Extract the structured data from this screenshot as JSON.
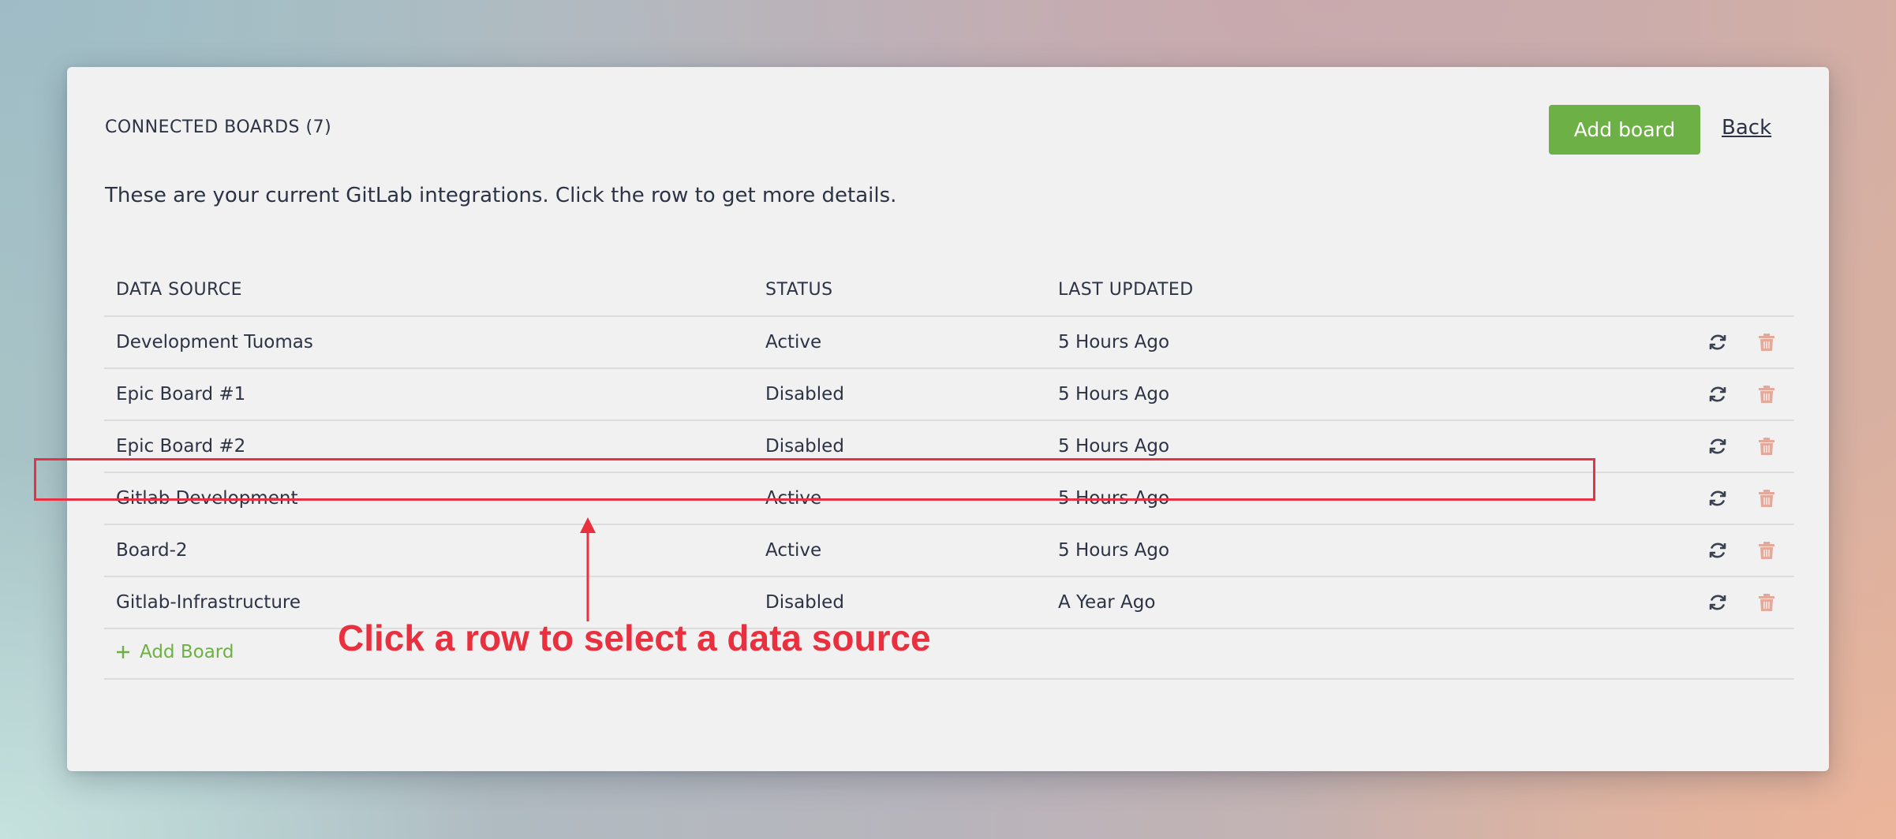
{
  "header": {
    "title": "CONNECTED BOARDS (7)",
    "add_button_label": "Add board",
    "back_label": "Back"
  },
  "intro_text": "These are your current GitLab integrations. Click the row to get more details.",
  "table": {
    "columns": [
      "DATA SOURCE",
      "STATUS",
      "LAST UPDATED"
    ],
    "rows": [
      {
        "source": "Development Tuomas",
        "status": "Active",
        "updated": "5 Hours Ago"
      },
      {
        "source": "Epic Board #1",
        "status": "Disabled",
        "updated": "5 Hours Ago"
      },
      {
        "source": "Epic Board #2",
        "status": "Disabled",
        "updated": "5 Hours Ago"
      },
      {
        "source": "Gitlab Development",
        "status": "Active",
        "updated": "5 Hours Ago"
      },
      {
        "source": "Board-2",
        "status": "Active",
        "updated": "5 Hours Ago"
      },
      {
        "source": "Gitlab-Infrastructure",
        "status": "Disabled",
        "updated": "A Year Ago"
      }
    ],
    "add_row_label": "Add Board"
  },
  "annotation": {
    "text": "Click a row to select a data source"
  },
  "icons": {
    "refresh": "refresh-icon",
    "delete": "trash-icon",
    "add": "plus-icon"
  },
  "colors": {
    "accent_green": "#6db045",
    "annotation_red": "#e8303f",
    "trash_muted": "#e4a99a",
    "text_dark": "#2b3345"
  }
}
